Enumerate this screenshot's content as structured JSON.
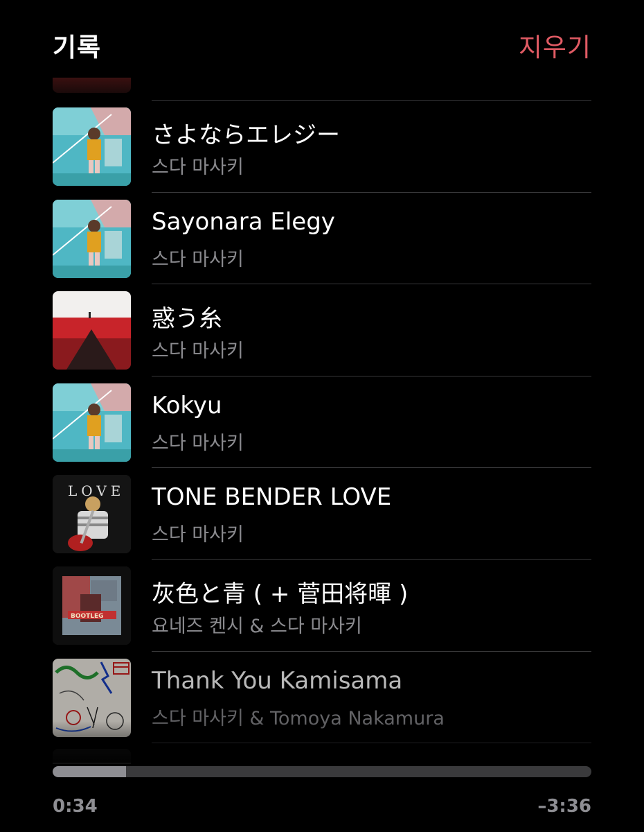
{
  "header": {
    "title": "기록",
    "clear_label": "지우기"
  },
  "history": [
    {
      "title": "さよならエレジー",
      "artist": "스다 마사키",
      "art": "cyan-boy-art"
    },
    {
      "title": "Sayonara Elegy",
      "artist": "스다 마사키",
      "art": "cyan-boy-art"
    },
    {
      "title": "惑う糸",
      "artist": "스다 마사키",
      "art": "red-field-art"
    },
    {
      "title": "Kokyu",
      "artist": "스다 마사키",
      "art": "cyan-boy-art"
    },
    {
      "title": "TONE BENDER LOVE",
      "artist": "스다 마사키",
      "art": "love-guitar-art"
    },
    {
      "title": "灰色と青 ( + 菅田将暉 )",
      "artist": "요네즈 켄시 & 스다 마사키",
      "art": "bootleg-art"
    },
    {
      "title": "Thank You Kamisama",
      "artist": "스다 마사키 & Tomoya Nakamura",
      "art": "doodle-art"
    }
  ],
  "player": {
    "elapsed": "0:34",
    "remaining": "–3:36",
    "progress": 0.136
  },
  "colors": {
    "accent": "#e15b64",
    "secondary_text": "#8a8a8e",
    "divider": "#3a3a3c"
  }
}
